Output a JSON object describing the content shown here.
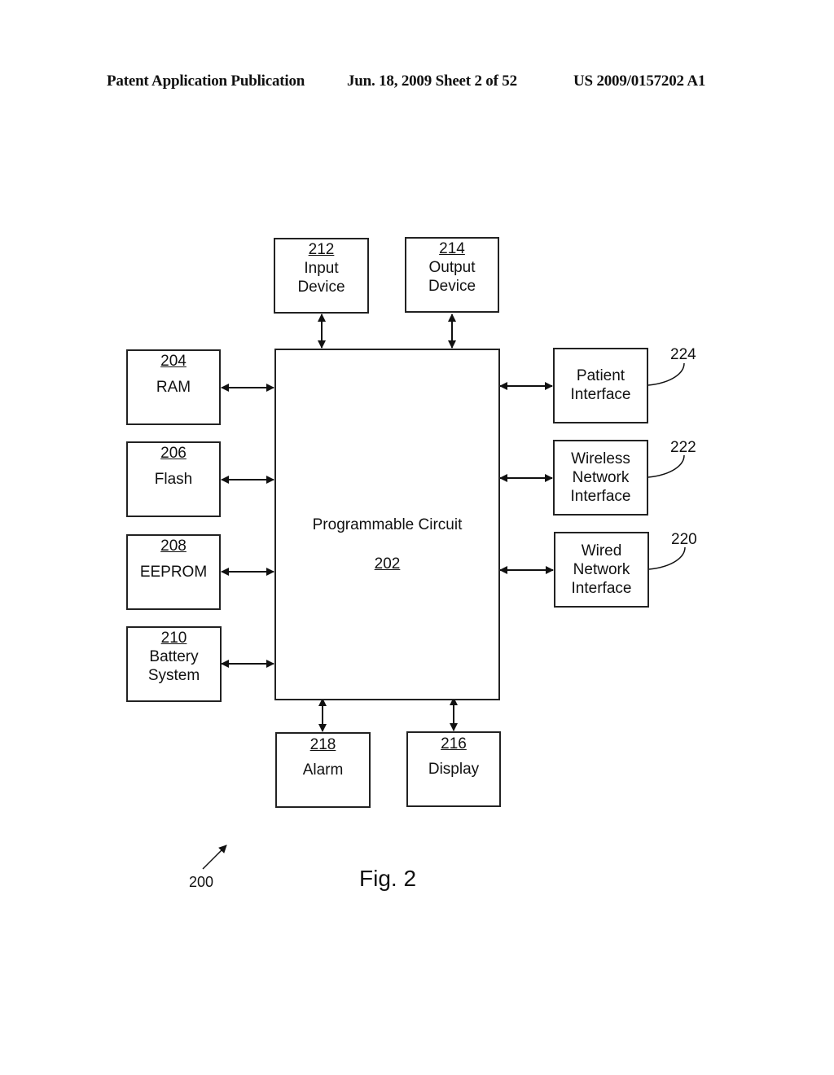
{
  "header": {
    "publication": "Patent Application Publication",
    "date_sheet": "Jun. 18, 2009  Sheet 2 of 52",
    "number": "US 2009/0157202 A1"
  },
  "diagram": {
    "center": {
      "label": "Programmable Circuit",
      "ref": "202"
    },
    "blocks": {
      "input_device": {
        "ref": "212",
        "label": "Input\nDevice"
      },
      "output_device": {
        "ref": "214",
        "label": "Output\nDevice"
      },
      "ram": {
        "ref": "204",
        "label": "RAM"
      },
      "flash": {
        "ref": "206",
        "label": "Flash"
      },
      "eeprom": {
        "ref": "208",
        "label": "EEPROM"
      },
      "battery": {
        "ref": "210",
        "label": "Battery\nSystem"
      },
      "alarm": {
        "ref": "218",
        "label": "Alarm"
      },
      "display": {
        "ref": "216",
        "label": "Display"
      },
      "patient_interface": {
        "ref": "224",
        "label": "Patient\nInterface"
      },
      "wireless_interface": {
        "ref": "222",
        "label": "Wireless\nNetwork\nInterface"
      },
      "wired_interface": {
        "ref": "220",
        "label": "Wired\nNetwork\nInterface"
      }
    },
    "figure_ref": "200",
    "caption": "Fig. 2"
  }
}
